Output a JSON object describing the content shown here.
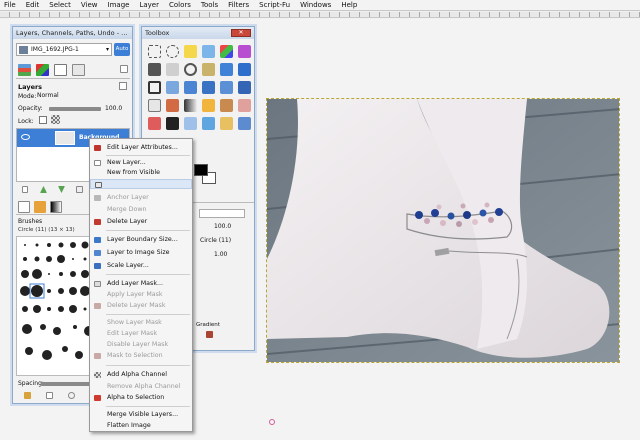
{
  "menubar": {
    "items": [
      "File",
      "Edit",
      "Select",
      "View",
      "Image",
      "Layer",
      "Colors",
      "Tools",
      "Filters",
      "Script-Fu",
      "Windows",
      "Help"
    ]
  },
  "layers_dock": {
    "title": "Layers, Channels, Paths, Undo - Br...",
    "image_selector": "IMG_1692.JPG-1",
    "auto_label": "Auto",
    "panel_title": "Layers",
    "mode_label": "Mode:",
    "mode_value": "Normal",
    "opacity_label": "Opacity:",
    "opacity_value": "100.0",
    "lock_label": "Lock:",
    "layer_name": "Background",
    "brushes_title": "Brushes",
    "brush_name": "Circle (11) (13 × 13)",
    "spacing_label": "Spacing:"
  },
  "toolbox": {
    "title": "Toolbox",
    "opacity_value": "100.0",
    "size_label": "Circle (11)",
    "scale_value": "1.00",
    "gradient_label": "Gradient"
  },
  "context_menu": {
    "items": [
      {
        "label": "Edit Layer Attributes...",
        "icon": "edit-attributes-icon",
        "enabled": true
      },
      {
        "label": "New Layer...",
        "icon": "new-layer-icon",
        "enabled": true
      },
      {
        "label": "New from Visible",
        "icon": "",
        "enabled": true
      },
      {
        "label": "Duplicate Layer",
        "icon": "duplicate-layer-icon",
        "enabled": true,
        "highlighted": true
      },
      {
        "label": "Anchor Layer",
        "icon": "anchor-icon",
        "enabled": false
      },
      {
        "label": "Merge Down",
        "icon": "",
        "enabled": false
      },
      {
        "label": "Delete Layer",
        "icon": "delete-layer-icon",
        "enabled": true
      },
      {
        "label": "Layer Boundary Size...",
        "icon": "layer-boundary-icon",
        "enabled": true
      },
      {
        "label": "Layer to Image Size",
        "icon": "layer-to-image-icon",
        "enabled": true
      },
      {
        "label": "Scale Layer...",
        "icon": "scale-layer-icon",
        "enabled": true
      },
      {
        "label": "Add Layer Mask...",
        "icon": "add-mask-icon",
        "enabled": true
      },
      {
        "label": "Apply Layer Mask",
        "icon": "",
        "enabled": false
      },
      {
        "label": "Delete Layer Mask",
        "icon": "delete-mask-icon",
        "enabled": false
      },
      {
        "label": "Show Layer Mask",
        "icon": "",
        "enabled": false
      },
      {
        "label": "Edit Layer Mask",
        "icon": "",
        "enabled": false
      },
      {
        "label": "Disable Layer Mask",
        "icon": "",
        "enabled": false
      },
      {
        "label": "Mask to Selection",
        "icon": "mask-selection-icon",
        "enabled": false
      },
      {
        "label": "Add Alpha Channel",
        "icon": "add-alpha-icon",
        "enabled": true
      },
      {
        "label": "Remove Alpha Channel",
        "icon": "",
        "enabled": false
      },
      {
        "label": "Alpha to Selection",
        "icon": "alpha-selection-icon",
        "enabled": true
      },
      {
        "label": "Merge Visible Layers...",
        "icon": "",
        "enabled": true
      },
      {
        "label": "Flatten Image",
        "icon": "",
        "enabled": true
      }
    ]
  },
  "colors": {
    "title_gradient_top": "#e3ebf6",
    "title_gradient_bottom": "#c9d7ea",
    "menu_highlight": "#dbe7f6",
    "selection_blue": "#3d7fd6",
    "photo_bg": "#7d8892"
  }
}
